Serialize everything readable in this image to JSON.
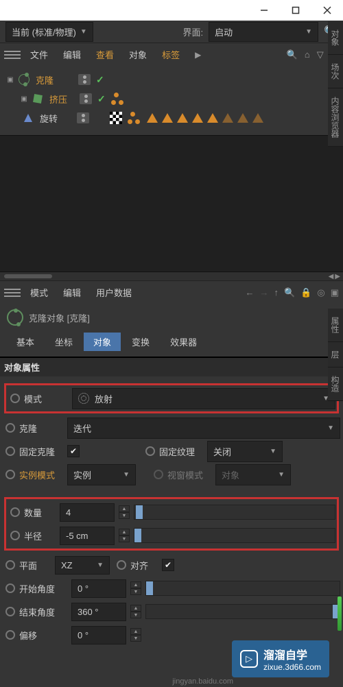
{
  "layout_dropdown": "当前 (标准/物理)",
  "interface_label": "界面:",
  "interface_value": "启动",
  "menus": {
    "file": "文件",
    "edit": "编辑",
    "view": "查看",
    "object": "对象",
    "tag": "标签"
  },
  "tree": {
    "clone": "克隆",
    "extrude": "挤压",
    "rotate": "旋转"
  },
  "attr_menus": {
    "mode": "模式",
    "edit": "编辑",
    "userdata": "用户数据"
  },
  "obj_title": "克隆对象 [克隆]",
  "tabs": {
    "basic": "基本",
    "coord": "坐标",
    "object": "对象",
    "transform": "变换",
    "effector": "效果器"
  },
  "section": "对象属性",
  "attrs": {
    "mode_label": "模式",
    "mode_value": "放射",
    "clone_label": "克隆",
    "clone_value": "迭代",
    "fixclone_label": "固定克隆",
    "fixtex_label": "固定纹理",
    "fixtex_value": "关闭",
    "instmode_label": "实例模式",
    "instmode_value": "实例",
    "viewmode_label": "视窗模式",
    "viewmode_value": "对象",
    "count_label": "数量",
    "count_value": "4",
    "radius_label": "半径",
    "radius_value": "-5 cm",
    "plane_label": "平面",
    "plane_value": "XZ",
    "align_label": "对齐",
    "startangle_label": "开始角度",
    "startangle_value": "0 °",
    "endangle_label": "结束角度",
    "endangle_value": "360 °",
    "offset_label": "偏移",
    "offset_value": "0 °"
  },
  "side": {
    "objects": "对象",
    "scenes": "场次",
    "content": "内容浏览器",
    "attributes": "属性",
    "layers": "层",
    "structure": "构造"
  },
  "watermark": {
    "brand": "溜溜自学",
    "url": "zixue.3d66.com"
  },
  "footer_url": "jingyan.baidu.com"
}
